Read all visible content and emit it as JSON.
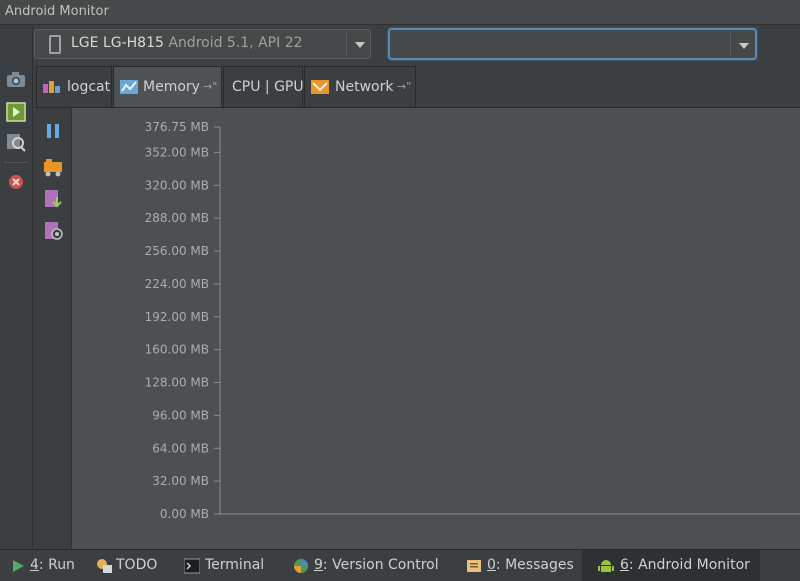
{
  "window": {
    "title": "Android Monitor"
  },
  "device": {
    "name": "LGE LG-H815",
    "version": "Android 5.1, API 22",
    "icon": "phone-icon"
  },
  "process": {
    "value": ""
  },
  "tabs": [
    {
      "label": "logcat",
      "icon": "logcat-icon",
      "selected": false,
      "pin": ""
    },
    {
      "label": "Memory",
      "icon": "memory-icon",
      "selected": true,
      "pin": "→\""
    },
    {
      "label": "CPU | GPU",
      "icon": "",
      "selected": false,
      "pin": ""
    },
    {
      "label": "Network",
      "icon": "network-icon",
      "selected": false,
      "pin": "→\""
    }
  ],
  "left_toolbar": [
    "screenshot-camera-icon",
    "screen-record-icon",
    "system-info-icon",
    "terminate-app-icon"
  ],
  "memory_toolbar": [
    "pause-icon",
    "initiate-gc-icon",
    "dump-java-heap-icon",
    "allocation-tracking-icon"
  ],
  "chart_data": {
    "type": "area",
    "title": "",
    "xlabel": "",
    "ylabel": "",
    "ylim": [
      0,
      376.75
    ],
    "y_ticks": [
      "376.75 MB",
      "352.00 MB",
      "320.00 MB",
      "288.00 MB",
      "256.00 MB",
      "224.00 MB",
      "192.00 MB",
      "160.00 MB",
      "128.00 MB",
      "96.00 MB",
      "64.00 MB",
      "32.00 MB",
      "0.00 MB"
    ],
    "y_tick_values": [
      376.75,
      352,
      320,
      288,
      256,
      224,
      192,
      160,
      128,
      96,
      64,
      32,
      0
    ],
    "series": [],
    "grid": false
  },
  "bottom_tabs": [
    {
      "num": "4",
      "rest": ": Run",
      "label_plain": "",
      "icon": "run-icon",
      "active": false
    },
    {
      "num": "",
      "rest": "",
      "label_plain": "TODO",
      "icon": "todo-icon",
      "active": false
    },
    {
      "num": "",
      "rest": "",
      "label_plain": "Terminal",
      "icon": "terminal-icon",
      "active": false
    },
    {
      "num": "9",
      "rest": ": Version Control",
      "label_plain": "",
      "icon": "version-control-icon",
      "active": false
    },
    {
      "num": "0",
      "rest": ": Messages",
      "label_plain": "",
      "icon": "messages-icon",
      "active": false
    },
    {
      "num": "6",
      "rest": ": Android Monitor",
      "label_plain": "",
      "icon": "android-icon",
      "active": true
    }
  ]
}
